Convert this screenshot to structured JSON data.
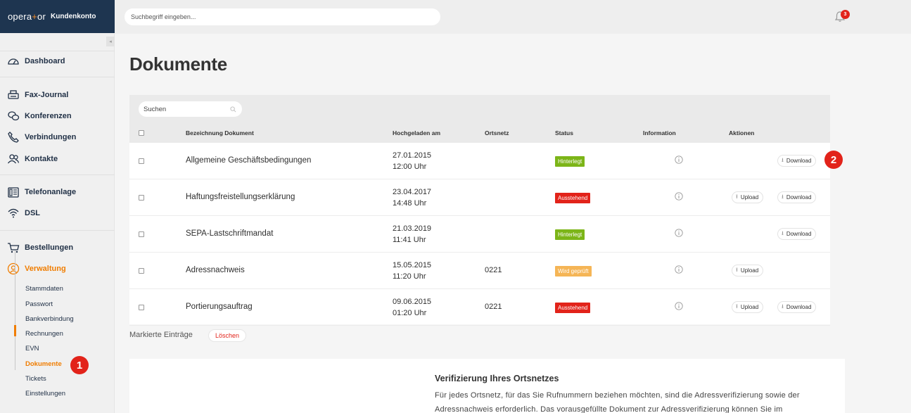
{
  "brand": {
    "logo_left": "opera",
    "logo_plus": "+",
    "logo_right": "or",
    "subtitle": "Kundenkonto"
  },
  "search": {
    "placeholder": "Suchbegriff eingeben..."
  },
  "notifications": {
    "count": "3"
  },
  "sidebar": {
    "collapse_glyph": "◂",
    "items": [
      {
        "label": "Dashboard",
        "icon": "dashboard-icon"
      },
      {
        "label": "Fax-Journal",
        "icon": "fax-icon"
      },
      {
        "label": "Konferenzen",
        "icon": "conference-icon"
      },
      {
        "label": "Verbindungen",
        "icon": "phone-icon"
      },
      {
        "label": "Kontakte",
        "icon": "contacts-icon"
      },
      {
        "label": "Telefonanlage",
        "icon": "phone-system-icon"
      },
      {
        "label": "DSL",
        "icon": "wifi-icon"
      },
      {
        "label": "Bestellungen",
        "icon": "cart-icon"
      },
      {
        "label": "Verwaltung",
        "icon": "user-circle-icon",
        "active": true
      }
    ],
    "subitems": [
      "Stammdaten",
      "Passwort",
      "Bankverbindung",
      "Rechnungen",
      "EVN",
      "Dokumente",
      "Tickets",
      "Einstellungen"
    ],
    "active_subitem": "Dokumente"
  },
  "markers": [
    "1",
    "2"
  ],
  "main": {
    "title": "Dokumente",
    "table": {
      "search_placeholder": "Suchen",
      "columns": [
        "Bezeichnung Dokument",
        "Hochgeladen am",
        "Ortsnetz",
        "Status",
        "Information",
        "Aktionen"
      ],
      "rows": [
        {
          "name": "Allgemeine Geschäftsbedingungen",
          "date": "27.01.2015",
          "time": "12:00 Uhr",
          "ortsnetz": "",
          "status": "Hinterlegt",
          "status_color": "#7cb518",
          "upload": "",
          "download": "Download"
        },
        {
          "name": "Haftungsfreistellungserklärung",
          "date": "23.04.2017",
          "time": "14:48 Uhr",
          "ortsnetz": "",
          "status": "Ausstehend",
          "status_color": "#e2231a",
          "upload": "Upload",
          "download": "Download"
        },
        {
          "name": "SEPA-Lastschriftmandat",
          "date": "21.03.2019",
          "time": "11:41 Uhr",
          "ortsnetz": "",
          "status": "Hinterlegt",
          "status_color": "#7cb518",
          "upload": "",
          "download": "Download"
        },
        {
          "name": "Adressnachweis",
          "date": "15.05.2015",
          "time": "11:20 Uhr",
          "ortsnetz": "0221",
          "status": "Wird geprüft",
          "status_color": "#f5b556",
          "upload": "Upload",
          "download": ""
        },
        {
          "name": "Portierungsauftrag",
          "date": "09.06.2015",
          "time": "01:20 Uhr",
          "ortsnetz": "0221",
          "status": "Ausstehend",
          "status_color": "#e2231a",
          "upload": "Upload",
          "download": "Download"
        }
      ]
    },
    "marked_label": "Markierte Einträge",
    "delete_label": "Löschen",
    "info": {
      "title": "Verifizierung Ihres Ortsnetzes",
      "text": "Für jedes Ortsnetz, für das Sie Rufnummern beziehen möchten, sind die Adressverifizierung sowie der Adressnachweis erforderlich. Das vorausgefüllte Dokument zur Adressverifizierung können Sie im"
    }
  }
}
